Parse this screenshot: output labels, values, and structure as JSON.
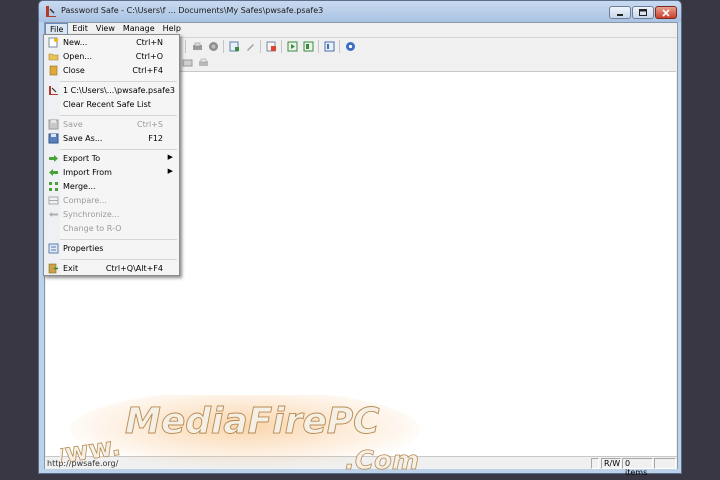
{
  "window": {
    "title": "Password Safe - C:\\Users\\f ... Documents\\My Safes\\pwsafe.psafe3"
  },
  "menubar": {
    "items": [
      {
        "label": "File"
      },
      {
        "label": "Edit"
      },
      {
        "label": "View"
      },
      {
        "label": "Manage"
      },
      {
        "label": "Help"
      }
    ]
  },
  "file_menu": {
    "new": {
      "label": "New...",
      "shortcut": "Ctrl+N"
    },
    "open": {
      "label": "Open...",
      "shortcut": "Ctrl+O"
    },
    "close": {
      "label": "Close",
      "shortcut": "Ctrl+F4"
    },
    "recent1": {
      "label": "1 C:\\Users\\...\\pwsafe.psafe3"
    },
    "clear_recent": {
      "label": "Clear Recent Safe List"
    },
    "save": {
      "label": "Save",
      "shortcut": "Ctrl+S"
    },
    "save_as": {
      "label": "Save As...",
      "shortcut": "F12"
    },
    "export_to": {
      "label": "Export To"
    },
    "import_from": {
      "label": "Import From"
    },
    "merge": {
      "label": "Merge..."
    },
    "compare": {
      "label": "Compare..."
    },
    "synchronize": {
      "label": "Synchronize..."
    },
    "change_ro": {
      "label": "Change to R-O"
    },
    "properties": {
      "label": "Properties"
    },
    "exit": {
      "label": "Exit",
      "shortcut": "Ctrl+Q\\Alt+F4"
    }
  },
  "statusbar": {
    "url": "http://pwsafe.org/",
    "mode": "R/W",
    "items": "0 items"
  },
  "watermark": {
    "line1": "MediaFirePC",
    "line2": ".Com",
    "prefix": "www."
  },
  "colors": {
    "accent": "#dce7f5",
    "close_button": "#c8412c",
    "desktop": "#3a3745"
  }
}
